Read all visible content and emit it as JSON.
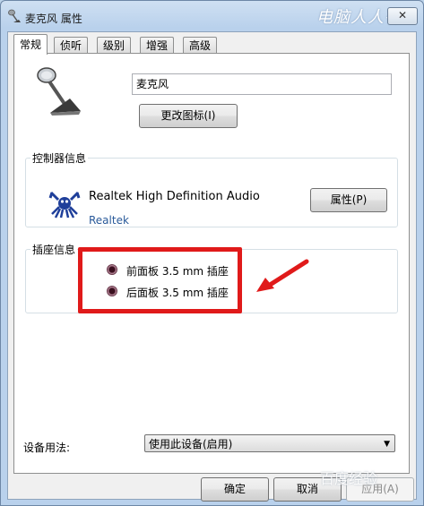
{
  "window": {
    "title": "麦克风 属性",
    "close_glyph": "✕"
  },
  "watermark": {
    "top": "电脑人人有",
    "bottom": "百度经验"
  },
  "tabs": [
    {
      "label": "常规",
      "active": true
    },
    {
      "label": "侦听",
      "active": false
    },
    {
      "label": "级别",
      "active": false
    },
    {
      "label": "增强",
      "active": false
    },
    {
      "label": "高级",
      "active": false
    }
  ],
  "general": {
    "device_name_value": "麦克风",
    "change_icon_label": "更改图标(I)"
  },
  "controller": {
    "group_label": "控制器信息",
    "name": "Realtek High Definition Audio",
    "vendor": "Realtek",
    "properties_label": "属性(P)"
  },
  "jacks": {
    "group_label": "插座信息",
    "items": [
      {
        "label": "前面板 3.5 mm 插座"
      },
      {
        "label": "后面板 3.5 mm 插座"
      }
    ]
  },
  "usage": {
    "label": "设备用法:",
    "selected": "使用此设备(启用)"
  },
  "buttons": {
    "ok": "确定",
    "cancel": "取消",
    "apply": "应用(A)"
  },
  "colors": {
    "highlight": "#e01a1a",
    "title_bar": "#b9d1ec"
  }
}
